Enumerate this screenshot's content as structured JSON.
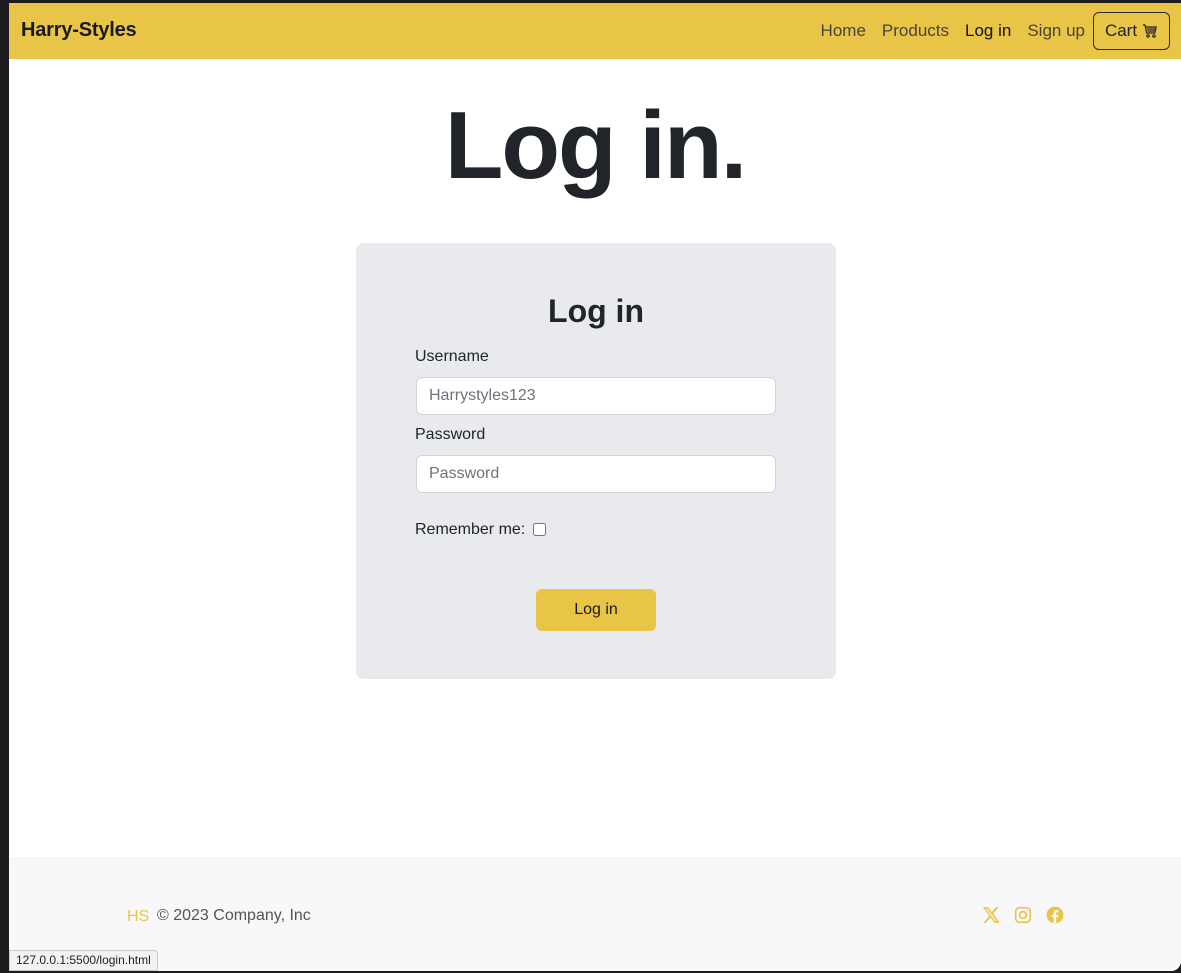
{
  "navbar": {
    "brand": "Harry-Styles",
    "links": [
      "Home",
      "Products",
      "Log in",
      "Sign up"
    ],
    "cart_label": "Cart",
    "accent": "#e8c547"
  },
  "main": {
    "title": "Log in."
  },
  "login_card": {
    "title": "Log in",
    "username_label": "Username",
    "username_placeholder": "Harrystyles123",
    "password_label": "Password",
    "password_placeholder": "Password",
    "remember_label": "Remember me:",
    "remember_checked": false,
    "submit_label": "Log in"
  },
  "footer": {
    "logo": "HS",
    "copyright": "© 2023 Company, Inc",
    "social_icons": [
      "x-twitter-icon",
      "instagram-icon",
      "facebook-icon"
    ]
  },
  "status_bar": {
    "url": "127.0.0.1:5500/login.html"
  }
}
